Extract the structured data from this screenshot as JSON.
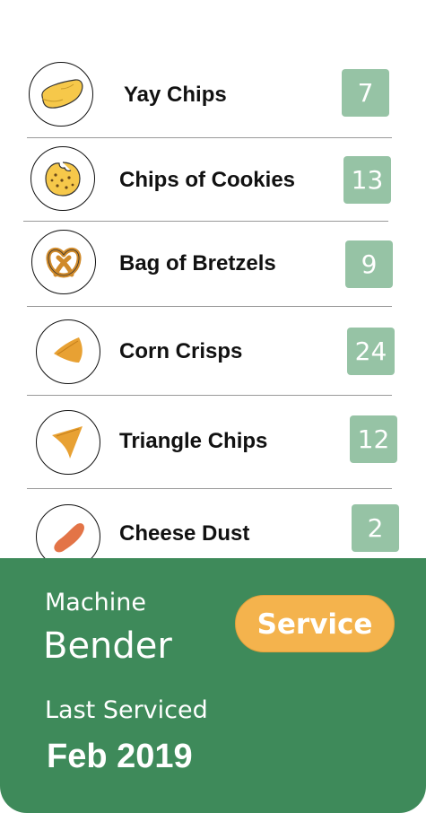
{
  "products": [
    {
      "name": "Yay Chips",
      "count": "7",
      "icon": "potato-chip-icon"
    },
    {
      "name": "Chips of Cookies",
      "count": "13",
      "icon": "cookie-icon"
    },
    {
      "name": "Bag of Bretzels",
      "count": "9",
      "icon": "pretzel-icon"
    },
    {
      "name": "Corn Crisps",
      "count": "24",
      "icon": "corn-crisp-icon"
    },
    {
      "name": "Triangle Chips",
      "count": "12",
      "icon": "triangle-chip-icon"
    },
    {
      "name": "Cheese Dust",
      "count": "2",
      "icon": "cheese-puff-icon"
    }
  ],
  "machine": {
    "label": "Machine",
    "name": "Bender",
    "last_serviced_label": "Last Serviced",
    "last_serviced_value": "Feb 2019",
    "service_button_label": "Service"
  },
  "colors": {
    "panel": "#3e8a5a",
    "badge": "#96c3a5",
    "service_button": "#f4b34d",
    "chip_yellow": "#f6c84a",
    "chip_orange": "#e8a133",
    "cheese_orange": "#e37447"
  }
}
